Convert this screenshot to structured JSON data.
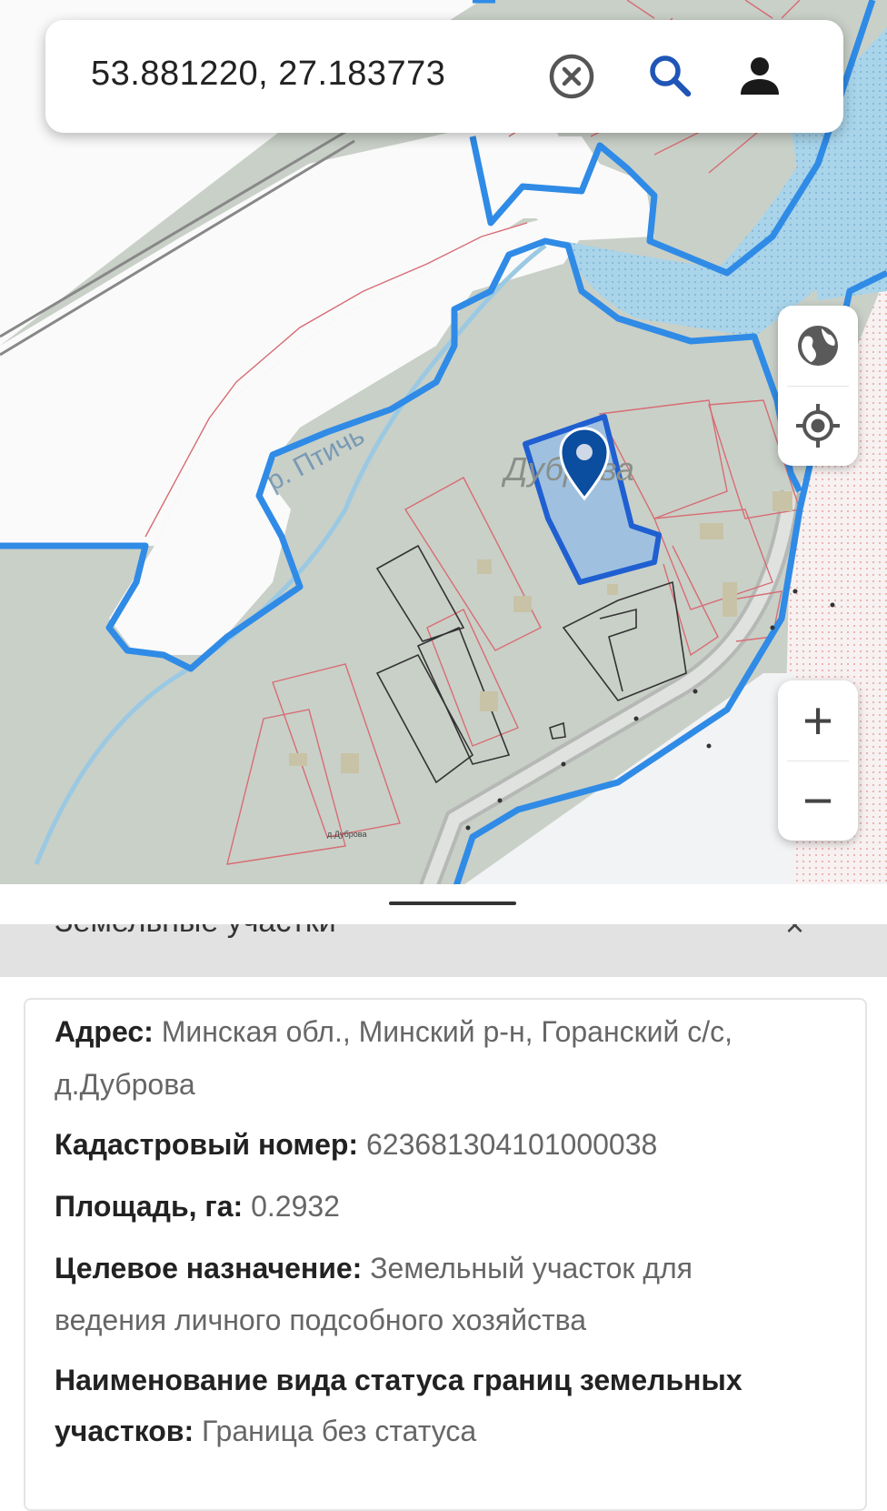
{
  "search": {
    "query": "53.881220, 27.183773"
  },
  "toolbar": {
    "clear_icon": "clear-circle-icon",
    "search_icon": "search-icon",
    "account_icon": "person-icon"
  },
  "map": {
    "river_label": "р. Птичь",
    "village_label": "Дуброва",
    "village_label_small": "д.Дуброва",
    "controls": {
      "layers_icon": "globe-icon",
      "locate_icon": "my-location-icon",
      "zoom_in_label": "+",
      "zoom_out_label": "−"
    },
    "colors": {
      "boundary": "#2f8be6",
      "water": "#a9d4ea",
      "selected_parcel": "#9fc1df",
      "marker": "#0b4d9e",
      "land": "#c9d0c8"
    }
  },
  "sheet": {
    "title": "Земельные участки",
    "close_label": "×",
    "details": {
      "address_label": "Адрес:",
      "address_value": "Минская обл., Минский р-н, Горанский с/с,",
      "address_value_2": "д.Дуброва",
      "cadastral_label": "Кадастровый номер:",
      "cadastral_value": "623681304101000038",
      "area_label": "Площадь, га:",
      "area_value": "0.2932",
      "purpose_label": "Целевое назначение:",
      "purpose_value": "Земельный участок для",
      "purpose_value_2": "ведения личного подсобного хозяйства",
      "status_label": "Наименование вида статуса границ земельных",
      "status_label_2": "участков:",
      "status_value": "Граница без статуса"
    }
  }
}
